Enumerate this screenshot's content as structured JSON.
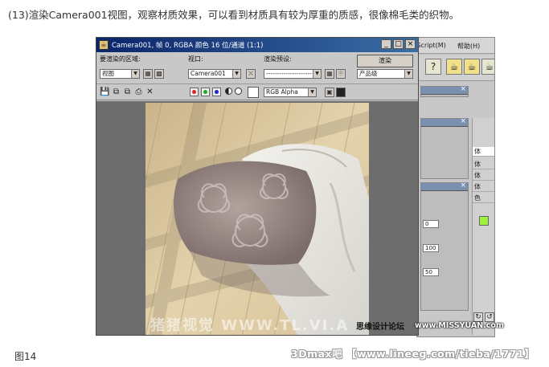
{
  "caption_top": "(13)渲染Camera001视图，观察材质效果，可以看到材质具有较为厚重的质感，很像棉毛类的织物。",
  "caption_bottom": "图14",
  "site_watermark": "3Dmax吧 【www.lineeg.com/tieba/1771】",
  "render_window": {
    "title": "Camera001, 帧 0, RGBA 颜色 16 位/通道 (1:1)",
    "area_label": "要渲染的区域:",
    "area_value": "视图",
    "viewport_label": "视口:",
    "viewport_value": "Camera001",
    "preset_label": "渲染预设:",
    "preset_value": "---------------------",
    "render_button": "渲染",
    "quality_value": "产品级",
    "channel_value": "RGB Alpha",
    "image_watermark": "猪猪视觉 WWW.TL.VI.A"
  },
  "background_app": {
    "menu_script": "XScript(M)",
    "menu_help": "帮助(H)",
    "help_glyph": "?",
    "cmd_labels": [
      "体",
      "体",
      "体",
      "体",
      "色"
    ],
    "field_values": [
      "0",
      "100",
      "50"
    ]
  },
  "overlay_watermarks": {
    "forum": "思缘设计论坛",
    "site": "www.MISSYUAN.com"
  },
  "colors": {
    "titlebar": "#0a246a",
    "floor": "#d9c69c",
    "pillow": "#9a8a86",
    "cloth": "#e8e6e0",
    "accent_green": "#9ef33a"
  }
}
